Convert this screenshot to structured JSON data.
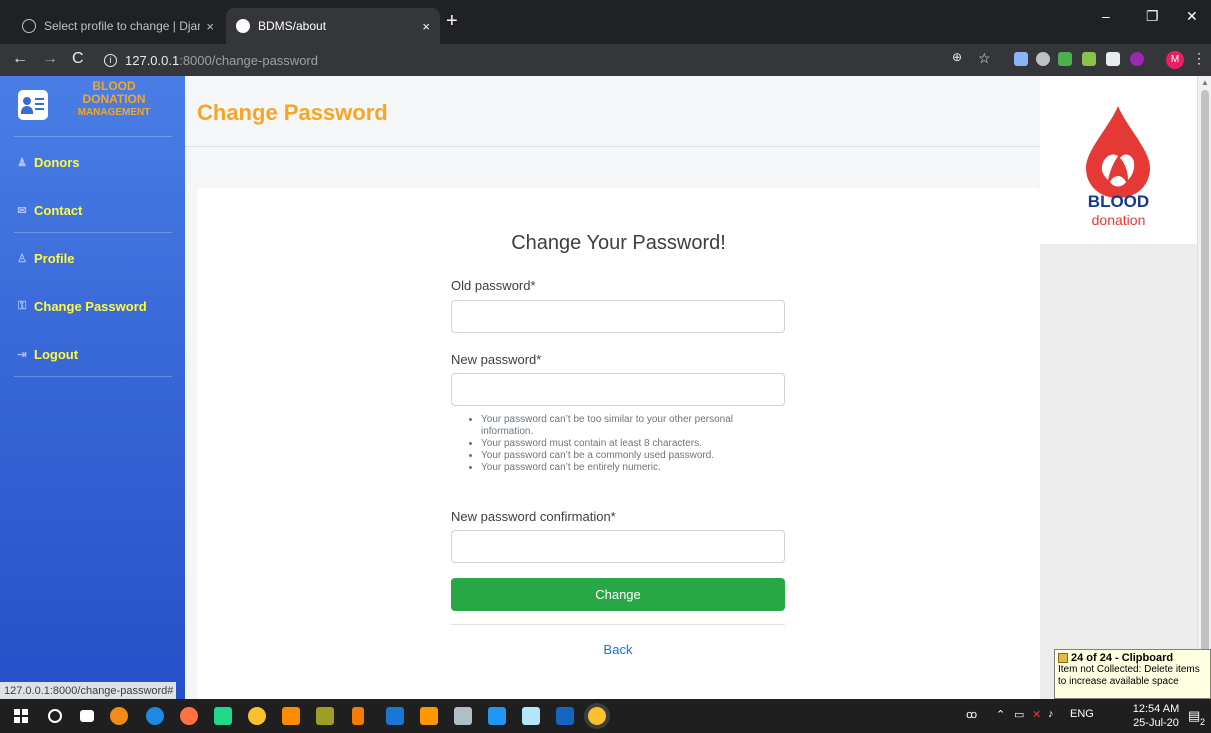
{
  "browser": {
    "tabs": [
      {
        "title": "Select profile to change | Django",
        "close": "×"
      },
      {
        "title": "BDMS/about",
        "close": "×"
      }
    ],
    "new_tab": "+",
    "url_host": "127.0.0.1",
    "url_path": ":8000/change-password",
    "avatar_letter": "M",
    "window_controls": [
      "–",
      "❐",
      "✕"
    ]
  },
  "sidebar": {
    "brand": {
      "line1": "BLOOD",
      "line2": "DONATION",
      "line3": "MANAGEMENT"
    },
    "items": [
      {
        "label": "Donors",
        "icon": "add-user-icon"
      },
      {
        "label": "Contact",
        "icon": "envelope-icon"
      },
      {
        "label": "Profile",
        "icon": "user-icon"
      },
      {
        "label": "Change Password",
        "icon": "key-icon"
      },
      {
        "label": "Logout",
        "icon": "logout-icon"
      }
    ]
  },
  "main": {
    "title": "Change Password",
    "form": {
      "heading": "Change Your Password!",
      "old_password_label": "Old password*",
      "new_password_label": "New password*",
      "help": [
        "Your password can’t be too similar to your other personal information.",
        "Your password must contain at least 8 characters.",
        "Your password can’t be a commonly used password.",
        "Your password can’t be entirely numeric."
      ],
      "confirm_label": "New password confirmation*",
      "submit_label": "Change",
      "back_label": "Back"
    }
  },
  "logo": {
    "word1": "BLOOD",
    "word2": "donation"
  },
  "status_url": "127.0.0.1:8000/change-password#",
  "clipboard": {
    "title": "24 of 24 - Clipboard",
    "message": "Item not Collected: Delete items to increase available space"
  },
  "taskbar": {
    "language": "ENG",
    "time": "12:54 AM",
    "date": "25-Jul-20",
    "notification_count": "2"
  },
  "colors": {
    "accent_orange": "#f5a623",
    "sidebar_link": "#fffa3a",
    "sidebar_blue": "#3a6ad8",
    "button_green": "#28a745",
    "link_blue": "#1a73e8"
  }
}
